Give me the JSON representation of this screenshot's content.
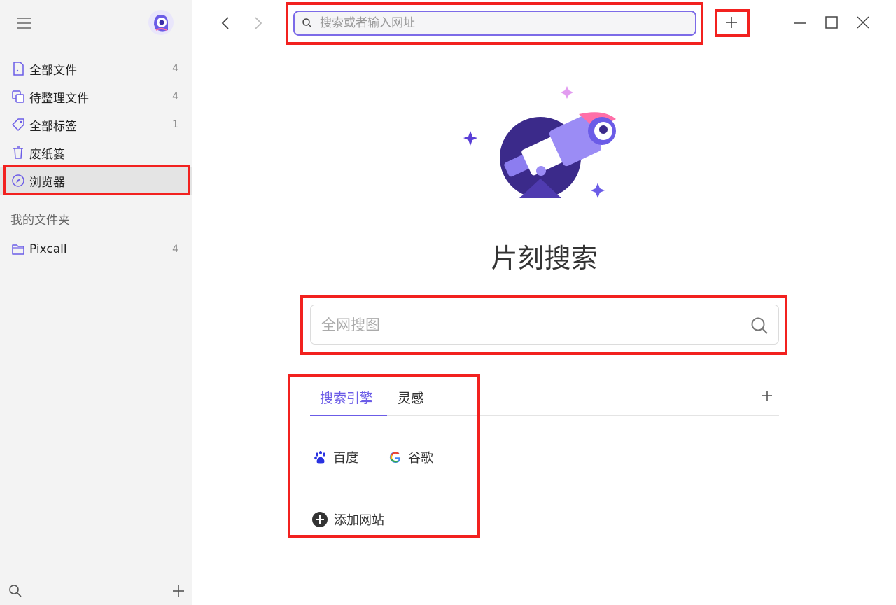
{
  "sidebar": {
    "nav": [
      {
        "label": "全部文件",
        "count": "4",
        "icon": "file-icon"
      },
      {
        "label": "待整理文件",
        "count": "4",
        "icon": "copy-icon"
      },
      {
        "label": "全部标签",
        "count": "1",
        "icon": "tag-icon"
      },
      {
        "label": "废纸篓",
        "count": "",
        "icon": "trash-icon"
      },
      {
        "label": "浏览器",
        "count": "",
        "icon": "compass-icon"
      }
    ],
    "section_title": "我的文件夹",
    "folders": [
      {
        "label": "Pixcall",
        "count": "4",
        "icon": "folder-icon"
      }
    ]
  },
  "topbar": {
    "url_placeholder": "搜索或者输入网址"
  },
  "main": {
    "brand": "片刻搜索",
    "search_placeholder": "全网搜图",
    "tabs": [
      {
        "label": "搜索引擎"
      },
      {
        "label": "灵感"
      }
    ],
    "engines": [
      {
        "label": "百度",
        "icon": "baidu-icon"
      },
      {
        "label": "谷歌",
        "icon": "google-icon"
      }
    ],
    "add_site": "添加网站"
  },
  "colors": {
    "accent": "#6b5ce7",
    "highlight": "#f2211f",
    "sidebar_bg": "#f3f3f3"
  }
}
